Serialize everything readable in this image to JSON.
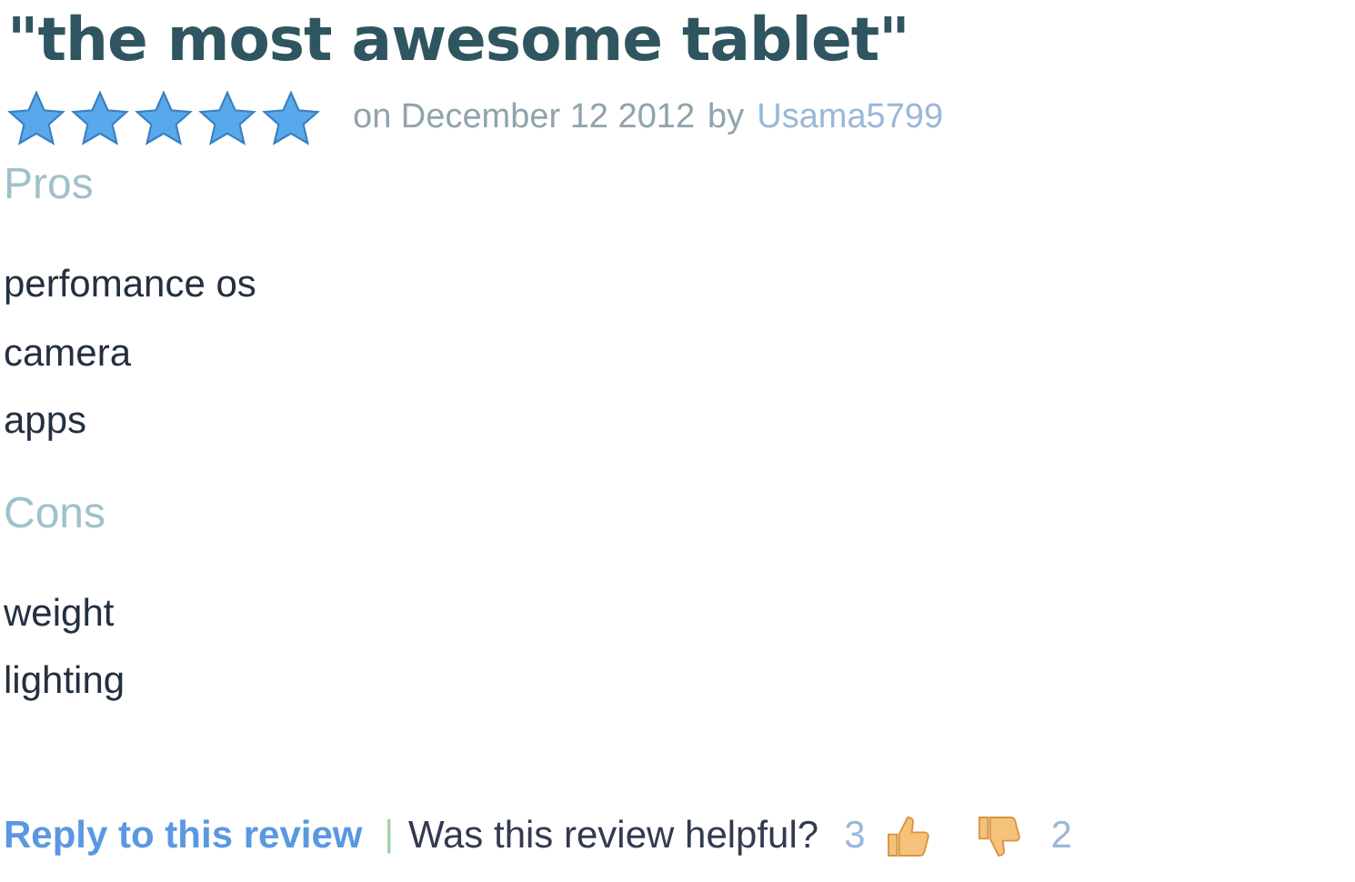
{
  "review": {
    "title": "\"the most awesome tablet\"",
    "stars": 5,
    "date": "on December 12  2012",
    "by": "by",
    "author": "Usama5799",
    "sections": [
      {
        "heading": "Pros",
        "items": [
          "perfomance os",
          "camera",
          "apps"
        ]
      },
      {
        "heading": "Cons",
        "items": [
          "weight",
          "lighting"
        ]
      }
    ],
    "reply_link": "Reply to this review",
    "separator": "|",
    "helpful_question": "Was this review helpful?",
    "up_count": "3",
    "down_count": "2"
  }
}
